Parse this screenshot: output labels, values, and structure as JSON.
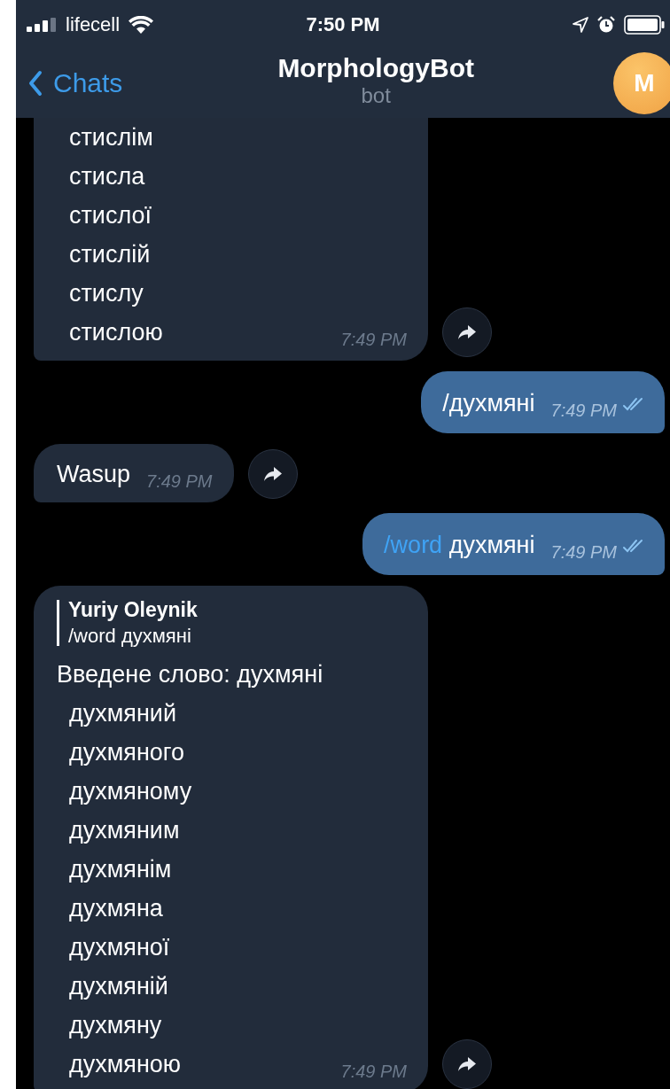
{
  "status_bar": {
    "carrier": "lifecell",
    "time": "7:50 PM"
  },
  "header": {
    "back_label": "Chats",
    "title": "MorphologyBot",
    "subtitle": "bot",
    "avatar_letter": "M"
  },
  "messages": [
    {
      "kind": "incoming",
      "lines": [
        "стислім",
        "стисла",
        "стислої",
        "стислій",
        "стислу",
        "стислою"
      ],
      "time": "7:49 PM",
      "forward": true
    },
    {
      "kind": "outgoing",
      "parts": [
        {
          "text": "/духмяні",
          "link": false
        }
      ],
      "time": "7:49 PM",
      "read": true
    },
    {
      "kind": "incoming",
      "heading": "Wasup",
      "time": "7:49 PM",
      "forward": true
    },
    {
      "kind": "outgoing",
      "parts": [
        {
          "text": "/word",
          "link": true
        },
        {
          "text": "духмяні",
          "link": false
        }
      ],
      "time": "7:49 PM",
      "read": true
    },
    {
      "kind": "incoming",
      "reply": {
        "author": "Yuriy Oleynik",
        "text": "/word духмяні"
      },
      "heading": "Введене слово: духмяні",
      "lines": [
        "духмяний",
        "духмяного",
        "духмяному",
        "духмяним",
        "духмянім",
        "духмяна",
        "духмяної",
        "духмяній",
        "духмяну",
        "духмяною"
      ],
      "time": "7:49 PM",
      "forward": true
    }
  ]
}
